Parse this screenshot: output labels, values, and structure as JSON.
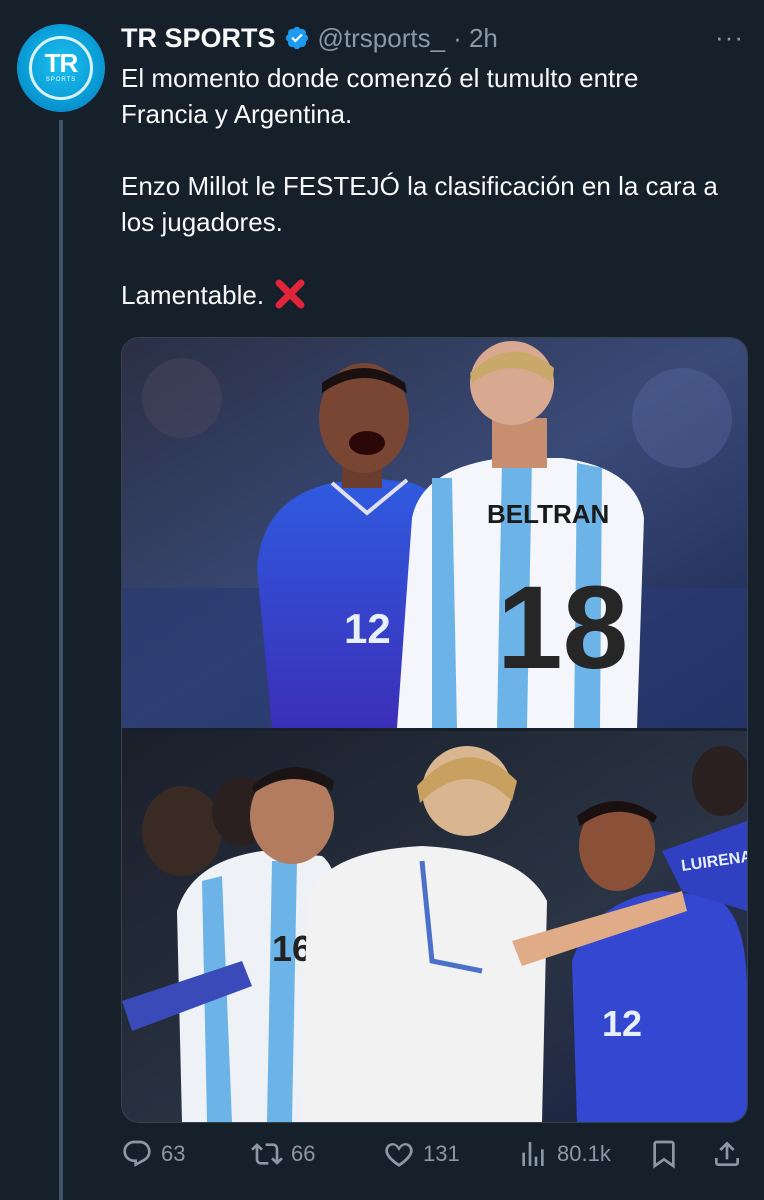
{
  "tweet": {
    "author_name": "TR SPORTS",
    "handle": "@trsports_",
    "time": "· 2h",
    "avatar_text": "TR",
    "avatar_subtext": "SPORTS",
    "more_label": "···",
    "paragraphs": [
      "El momento donde comenzó el tumulto entre Francia y Argentina.",
      "Enzo Millot le FESTEJÓ la clasificación en la cara a los jugadores.",
      "Lamentable."
    ],
    "photo1": {
      "jersey_name": "BELTRAN",
      "jersey_number_back": "18",
      "jersey_number_front": "12"
    },
    "photo2": {
      "number_left": "16",
      "number_right": "12",
      "back_text": "LUIRENA"
    }
  },
  "actions": {
    "replies": "63",
    "reposts": "66",
    "likes": "131",
    "views": "80.1k"
  },
  "colors": {
    "background": "#15202b",
    "text": "#f7f9f9",
    "secondary": "#8b98a5",
    "verified": "#1d9bf0",
    "x_mark": "#e0253a"
  },
  "icons": [
    "verified-badge-icon",
    "more-icon",
    "x-mark-icon",
    "reply-icon",
    "repost-icon",
    "like-icon",
    "views-icon",
    "bookmark-icon",
    "share-icon"
  ]
}
